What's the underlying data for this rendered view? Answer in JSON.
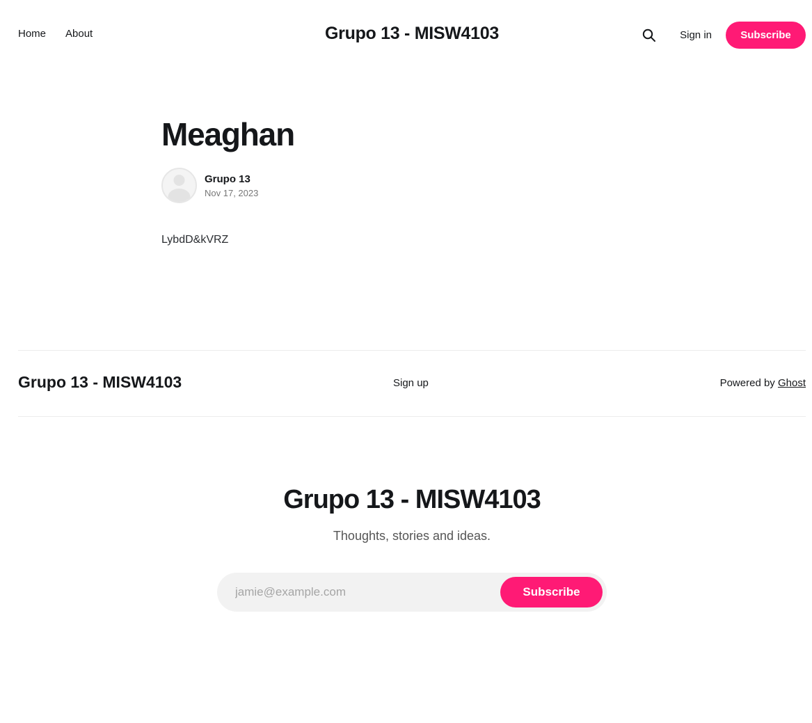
{
  "header": {
    "nav": [
      {
        "label": "Home"
      },
      {
        "label": "About"
      }
    ],
    "site_title": "Grupo 13 - MISW4103",
    "search_icon": "search-icon",
    "sign_in_label": "Sign in",
    "subscribe_label": "Subscribe",
    "accent_color": "#ff1a75"
  },
  "post": {
    "title": "Meaghan",
    "author": "Grupo 13",
    "date": "Nov 17, 2023",
    "body": "LybdD&kVRZ"
  },
  "footer": {
    "site_title": "Grupo 13 - MISW4103",
    "signup_label": "Sign up",
    "powered_prefix": "Powered by",
    "powered_link": "Ghost"
  },
  "cta": {
    "title": "Grupo 13 - MISW4103",
    "description": "Thoughts, stories and ideas.",
    "email_placeholder": "jamie@example.com",
    "button_label": "Subscribe"
  }
}
